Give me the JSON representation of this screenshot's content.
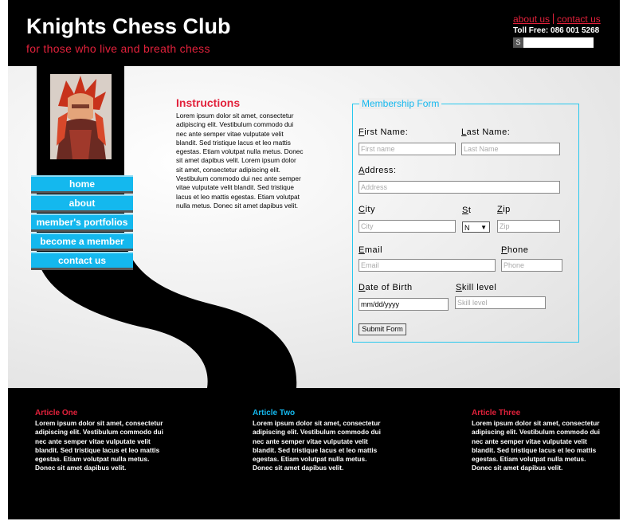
{
  "header": {
    "title": "Knights Chess Club",
    "tagline": "for those who live and breath chess",
    "links": [
      "about us",
      "contact us"
    ],
    "toll_free": "Toll Free: 086 001 5268",
    "search_button": "S"
  },
  "nav": {
    "items": [
      "home",
      "about",
      "member's portfolios",
      "become a member",
      "contact us"
    ]
  },
  "instructions": {
    "title": "Instructions",
    "body": "Lorem ipsum dolor sit amet, consectetur adipiscing elit. Vestibulum commodo dui nec ante semper vitae vulputate velit blandit. Sed tristique lacus et leo mattis egestas. Etiam volutpat nulla metus. Donec sit amet dapibus velit. Lorem ipsum dolor sit amet, consectetur adipiscing elit. Vestibulum commodo dui nec ante semper vitae vulputate velit blandit. Sed tristique lacus et leo mattis egestas. Etiam volutpat nulla metus. Donec sit amet dapibus velit."
  },
  "form": {
    "legend": "Membership Form",
    "first_name": {
      "label_first": "F",
      "label_rest": "irst Name:",
      "placeholder": "First name"
    },
    "last_name": {
      "label_first": "L",
      "label_rest": "ast Name:",
      "placeholder": "Last Name"
    },
    "address": {
      "label_first": "A",
      "label_rest": "ddress:",
      "placeholder": "Address"
    },
    "city": {
      "label_first": "C",
      "label_rest": "ity",
      "placeholder": "City"
    },
    "state": {
      "label_first": "S",
      "label_rest": "t",
      "value": "N",
      "arrow": "▼"
    },
    "zip": {
      "label_first": "Z",
      "label_rest": "ip",
      "placeholder": "Zip"
    },
    "email": {
      "label_first": "E",
      "label_rest": "mail",
      "placeholder": "Email"
    },
    "phone": {
      "label_first": "P",
      "label_rest": "hone",
      "placeholder": "Phone"
    },
    "dob": {
      "label_first": "D",
      "label_rest": "ate of Birth",
      "value": "mm/dd/yyyy"
    },
    "skill": {
      "label_first": "S",
      "label_rest": "kill level",
      "placeholder": "Skill level"
    },
    "submit": "Submit Form"
  },
  "footer": {
    "articles": [
      {
        "title": "Article One",
        "color": "#e2213b",
        "body": "Lorem ipsum dolor sit amet, consectetur adipiscing elit. Vestibulum commodo dui nec ante semper vitae vulputate velit blandit. Sed tristique lacus et leo mattis egestas. Etiam volutpat nulla metus. Donec sit amet dapibus velit."
      },
      {
        "title": "Article Two",
        "color": "#14b8ee",
        "body": "Lorem ipsum dolor sit amet, consectetur adipiscing elit. Vestibulum commodo dui nec ante semper vitae vulputate velit blandit. Sed tristique lacus et leo mattis egestas. Etiam volutpat nulla metus. Donec sit amet dapibus velit."
      },
      {
        "title": "Article Three",
        "color": "#e2213b",
        "body": "Lorem ipsum dolor sit amet, consectetur adipiscing elit. Vestibulum commodo dui nec ante semper vitae vulputate velit blandit. Sed tristique lacus et leo mattis egestas. Etiam volutpat nulla metus. Donec sit amet dapibus velit."
      }
    ]
  }
}
